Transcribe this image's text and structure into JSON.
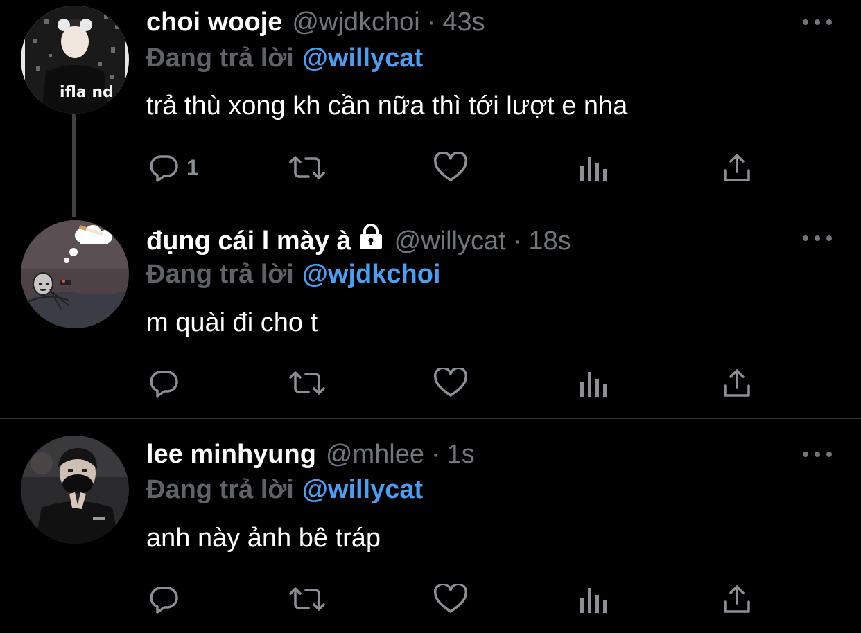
{
  "tweets": [
    {
      "name": "choi wooje",
      "handle": "@wjdkchoi",
      "separator": "·",
      "time": "43s",
      "replying_label": "Đang trả lời",
      "replying_to": "@willycat",
      "text": "trả thù xong kh cần nữa thì tới lượt e nha",
      "reply_count": "1",
      "avatar_text": "ifla nd"
    },
    {
      "name": "đụng cái l mày à",
      "handle": "@willycat",
      "separator": "·",
      "time": "18s",
      "replying_label": "Đang trả lời",
      "replying_to": "@wjdkchoi",
      "text": "m quài đi cho t",
      "reply_count": ""
    },
    {
      "name": "lee minhyung",
      "handle": "@mhlee",
      "separator": "·",
      "time": "1s",
      "replying_label": "Đang trả lời",
      "replying_to": "@willycat",
      "text": "anh này ảnh bê tráp",
      "reply_count": ""
    }
  ],
  "icons": {
    "reply": "reply-icon",
    "retweet": "retweet-icon",
    "like": "like-icon",
    "views": "views-icon",
    "share": "share-icon",
    "more": "more-icon",
    "protected": "lock-icon"
  },
  "colors": {
    "background": "#000000",
    "name": "#ffffff",
    "secondary": "#71767b",
    "mention": "#4a9ff5",
    "replying_label": "#5f6368",
    "icon": "#8b9096",
    "thread_line": "#3e4144"
  }
}
